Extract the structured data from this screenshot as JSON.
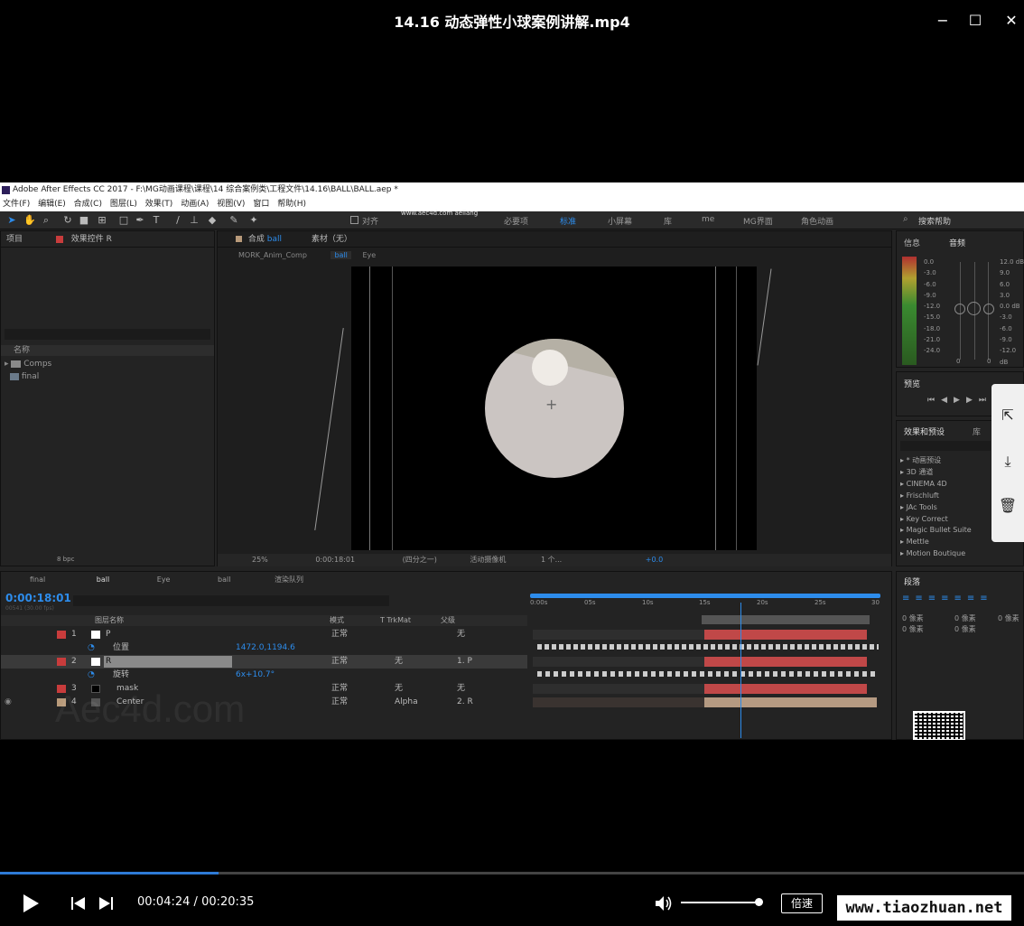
{
  "player": {
    "title": "14.16 动态弹性小球案例讲解.mp4",
    "controls": {
      "minimize": "−",
      "maximize": "☐",
      "close": "✕"
    },
    "current_time": "00:04:24",
    "total_time": "00:20:35",
    "time_separator": "/",
    "progress_fraction": 0.213,
    "volume_fraction": 1.0,
    "speed_label": "倍速",
    "watermark": "www.tiaozhuan.net",
    "accent_color": "#2e7bd6",
    "side_actions": [
      "share-icon",
      "download-icon",
      "trash-icon"
    ]
  },
  "ae": {
    "title": "Adobe After Effects CC 2017 - F:\\MG动画课程\\课程\\14 综合案例类\\工程文件\\14.16\\BALL\\BALL.aep *",
    "menu": [
      "文件(F)",
      "编辑(E)",
      "合成(C)",
      "图层(L)",
      "效果(T)",
      "动画(A)",
      "视图(V)",
      "窗口",
      "帮助(H)"
    ],
    "toolbar": {
      "align_label": "对齐",
      "watermark_text": "www.aec4d.com aeliang",
      "workspaces": [
        "必要项",
        "标准",
        "小屏幕",
        "库",
        "me",
        "MG界面",
        "角色动画"
      ],
      "active_workspace": "标准",
      "search_help": "搜索帮助"
    },
    "project_panel": {
      "tab": "项目",
      "effects_tab": "效果控件 R",
      "column_name": "名称",
      "items": [
        "Comps",
        "final"
      ],
      "bpc": "8 bpc"
    },
    "comp_panel": {
      "tab_prefix": "合成",
      "tab_name": "ball",
      "footage_tab": "素材（无）",
      "breadcrumb": [
        "MORK_Anim_Comp",
        "ball",
        "Eye"
      ],
      "zoom": "25%",
      "timecode": "0:00:18:01",
      "resolution": "(四分之一)",
      "camera": "活动摄像机",
      "views": "1 个...",
      "exposure": "+0.0"
    },
    "right_panels": {
      "info_tab": "信息",
      "audio_tab": "音频",
      "db_left": [
        "0.0",
        "-3.0",
        "-6.0",
        "-9.0",
        "-12.0",
        "-15.0",
        "-18.0",
        "-21.0",
        "-24.0"
      ],
      "db_right": [
        "12.0 dB",
        "9.0",
        "6.0",
        "3.0",
        "0.0 dB",
        "-3.0",
        "-6.0",
        "-9.0",
        "-12.0 dB"
      ],
      "zero_l": "0",
      "zero_r": "0",
      "preview_tab": "预览",
      "effects_tab": "效果和预设",
      "library_tab": "库",
      "effects_list": [
        "* 动画预设",
        "3D 通道",
        "CINEMA 4D",
        "Frischluft",
        "JAc Tools",
        "Key Correct",
        "Magic Bullet Suite",
        "Mettle",
        "Motion Boutique"
      ],
      "paragraph_tab": "段落",
      "px_labels": [
        "0 像素",
        "0 像素",
        "0 像素",
        "0 像素",
        "0 像素"
      ]
    },
    "timeline": {
      "tabs": [
        "final",
        "ball",
        "Eye",
        "ball",
        "渲染队列"
      ],
      "active_tab": "ball",
      "timecode": "0:00:18:01",
      "fps_note": "00541 (30.00 fps)",
      "col_layer": "图层名称",
      "col_mode": "模式",
      "col_trk": "T  TrkMat",
      "col_parent": "父级",
      "ruler": [
        "0:00s",
        "05s",
        "10s",
        "15s",
        "20s",
        "25s",
        "30"
      ],
      "playhead_fraction": 0.6,
      "layers": [
        {
          "num": "1",
          "name": "P",
          "mode": "正常",
          "trk": "",
          "parent": "无",
          "color": "#c83c3c"
        },
        {
          "num": "",
          "name": "位置",
          "mode": "",
          "trk": "",
          "parent": "",
          "value": "1472.0,1194.6",
          "color": ""
        },
        {
          "num": "2",
          "name": "R",
          "mode": "正常",
          "trk": "无",
          "parent": "1. P",
          "color": "#c83c3c"
        },
        {
          "num": "",
          "name": "旋转",
          "mode": "",
          "trk": "",
          "parent": "",
          "value": "6x+10.7°",
          "color": ""
        },
        {
          "num": "3",
          "name": "mask",
          "mode": "正常",
          "trk": "无",
          "parent": "无",
          "color": "#c83c3c"
        },
        {
          "num": "4",
          "name": "Center",
          "mode": "正常",
          "trk": "Alpha",
          "parent": "2. R",
          "color": "#b89a7a"
        }
      ],
      "aec_watermark": "Aec4d.com"
    }
  }
}
